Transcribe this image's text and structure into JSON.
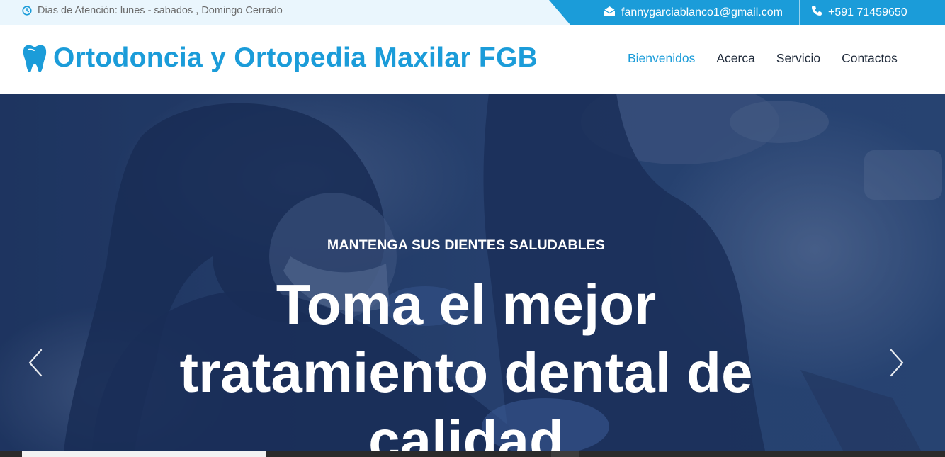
{
  "topbar": {
    "hours": "Dias de Atención: lunes - sabados , Domingo Cerrado",
    "email": "fannygarciablanco1@gmail.com",
    "phone": "+591 71459650"
  },
  "brand": {
    "name": "Ortodoncia y Ortopedia Maxilar FGB"
  },
  "nav": {
    "items": [
      {
        "label": "Bienvenidos",
        "active": true
      },
      {
        "label": "Acerca",
        "active": false
      },
      {
        "label": "Servicio",
        "active": false
      },
      {
        "label": "Contactos",
        "active": false
      }
    ]
  },
  "hero": {
    "subtitle": "MANTENGA SUS DIENTES SALUDABLES",
    "title_lines": [
      "Toma el mejor",
      "tratamiento dental de",
      "calidad"
    ]
  },
  "colors": {
    "accent": "#1b9cd9",
    "nav_text": "#1f2a3a",
    "topbar_bg": "#eaf6fd",
    "hero_overlay": "#223a64"
  },
  "icons": {
    "hours": "clock-icon",
    "email": "envelope-icon",
    "phone": "phone-icon",
    "brand": "tooth-icon",
    "prev": "chevron-left-icon",
    "next": "chevron-right-icon"
  }
}
